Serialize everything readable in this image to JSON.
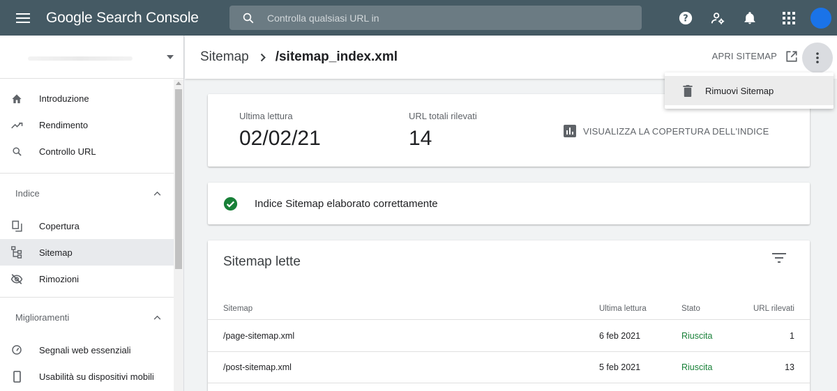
{
  "app": {
    "title": "Google Search Console"
  },
  "search": {
    "placeholder": "Controlla qualsiasi URL in"
  },
  "header": {
    "breadcrumb_root": "Sitemap",
    "breadcrumb_current": "/sitemap_index.xml",
    "open_sitemap": "APRI SITEMAP"
  },
  "menu": {
    "remove_sitemap": "Rimuovi Sitemap"
  },
  "sidebar": {
    "items_top": [
      {
        "label": "Introduzione",
        "icon": "home-icon"
      },
      {
        "label": "Rendimento",
        "icon": "trending-up-icon"
      },
      {
        "label": "Controllo URL",
        "icon": "search-icon"
      }
    ],
    "section_index": {
      "title": "Indice",
      "items": [
        {
          "label": "Copertura",
          "icon": "copy-icon"
        },
        {
          "label": "Sitemap",
          "icon": "sitemap-icon"
        },
        {
          "label": "Rimozioni",
          "icon": "visibility-off-icon"
        }
      ]
    },
    "section_improvements": {
      "title": "Miglioramenti",
      "items": [
        {
          "label": "Segnali web essenziali",
          "icon": "speed-icon"
        },
        {
          "label": "Usabilità su dispositivi mobili",
          "icon": "smartphone-icon"
        }
      ]
    }
  },
  "stats": {
    "last_read_label": "Ultima lettura",
    "last_read_value": "02/02/21",
    "urls_label": "URL totali rilevati",
    "urls_value": "14",
    "coverage_link": "VISUALIZZA LA COPERTURA DELL'INDICE"
  },
  "status": {
    "message": "Indice Sitemap elaborato correttamente"
  },
  "table": {
    "title": "Sitemap lette",
    "columns": [
      "Sitemap",
      "Ultima lettura",
      "Stato",
      "URL rilevati"
    ],
    "rows": [
      {
        "sitemap": "/page-sitemap.xml",
        "last_read": "6 feb 2021",
        "status": "Riuscita",
        "urls": "1"
      },
      {
        "sitemap": "/post-sitemap.xml",
        "last_read": "5 feb 2021",
        "status": "Riuscita",
        "urls": "13"
      }
    ]
  },
  "colors": {
    "topbar": "#455a64",
    "success": "#188038",
    "accent": "#1a73e8"
  }
}
